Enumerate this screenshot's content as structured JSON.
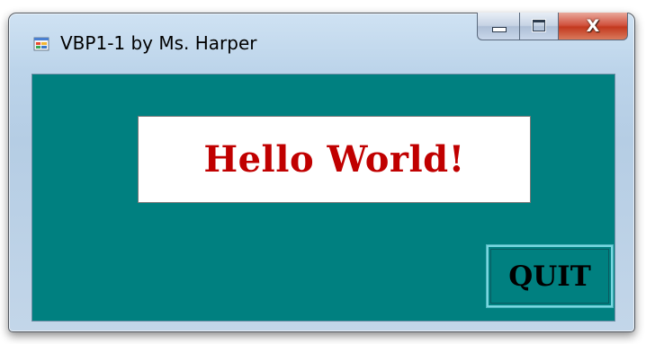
{
  "window": {
    "title": "VBP1-1 by Ms. Harper",
    "controls": {
      "minimize_icon": "minimize-icon",
      "maximize_icon": "maximize-icon",
      "close_label": "X"
    }
  },
  "form": {
    "background_color": "#008080",
    "hello_label": "Hello World!",
    "hello_color": "#c00000",
    "quit_button_label": "QUIT"
  }
}
